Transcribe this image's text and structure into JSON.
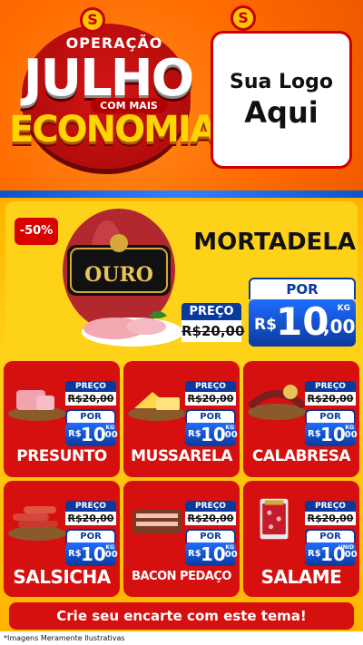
{
  "header": {
    "brand_top": "OPERAÇÃO",
    "brand_main": "JULHO",
    "brand_tag": "COM MAIS",
    "brand_bottom": "ECONOMIA",
    "brand_badge": "S",
    "logo_line1": "Sua Logo",
    "logo_line2": "Aqui"
  },
  "hero": {
    "discount_badge": "-50%",
    "product": "MORTADELA",
    "old_label": "PREÇO",
    "old_price": "R$20,00",
    "new_label": "POR",
    "currency": "R$",
    "new_int": "10",
    "new_dec": ",00",
    "unit": "KG",
    "package_brand": "OURO"
  },
  "cards": [
    {
      "name": "PRESUNTO",
      "old_label": "PREÇO",
      "old_price": "R$20,00",
      "new_label": "POR",
      "currency": "R$",
      "new_int": "10",
      "new_dec": ",00",
      "unit": "KG"
    },
    {
      "name": "MUSSARELA",
      "old_label": "PREÇO",
      "old_price": "R$20,00",
      "new_label": "POR",
      "currency": "R$",
      "new_int": "10",
      "new_dec": ",00",
      "unit": "KG"
    },
    {
      "name": "CALABRESA",
      "old_label": "PREÇO",
      "old_price": "R$20,00",
      "new_label": "POR",
      "currency": "R$",
      "new_int": "10",
      "new_dec": ",00",
      "unit": "KG"
    },
    {
      "name": "SALSICHA",
      "old_label": "PREÇO",
      "old_price": "R$20,00",
      "new_label": "POR",
      "currency": "R$",
      "new_int": "10",
      "new_dec": ",00",
      "unit": "KG"
    },
    {
      "name": "BACON PEDAÇO",
      "old_label": "PREÇO",
      "old_price": "R$20,00",
      "new_label": "POR",
      "currency": "R$",
      "new_int": "10",
      "new_dec": ",00",
      "unit": "KG"
    },
    {
      "name": "SALAME",
      "old_label": "PREÇO",
      "old_price": "R$20,00",
      "new_label": "POR",
      "currency": "R$",
      "new_int": "10",
      "new_dec": ",00",
      "unit": "UNID"
    }
  ],
  "cta": "Crie seu encarte com este tema!",
  "footer_note": "*Imagens Meramente Ilustrativas",
  "colors": {
    "accent_red": "#d60f0f",
    "accent_blue": "#0a3a9e",
    "accent_yellow": "#ffd21a",
    "accent_orange": "#ff6a08"
  }
}
